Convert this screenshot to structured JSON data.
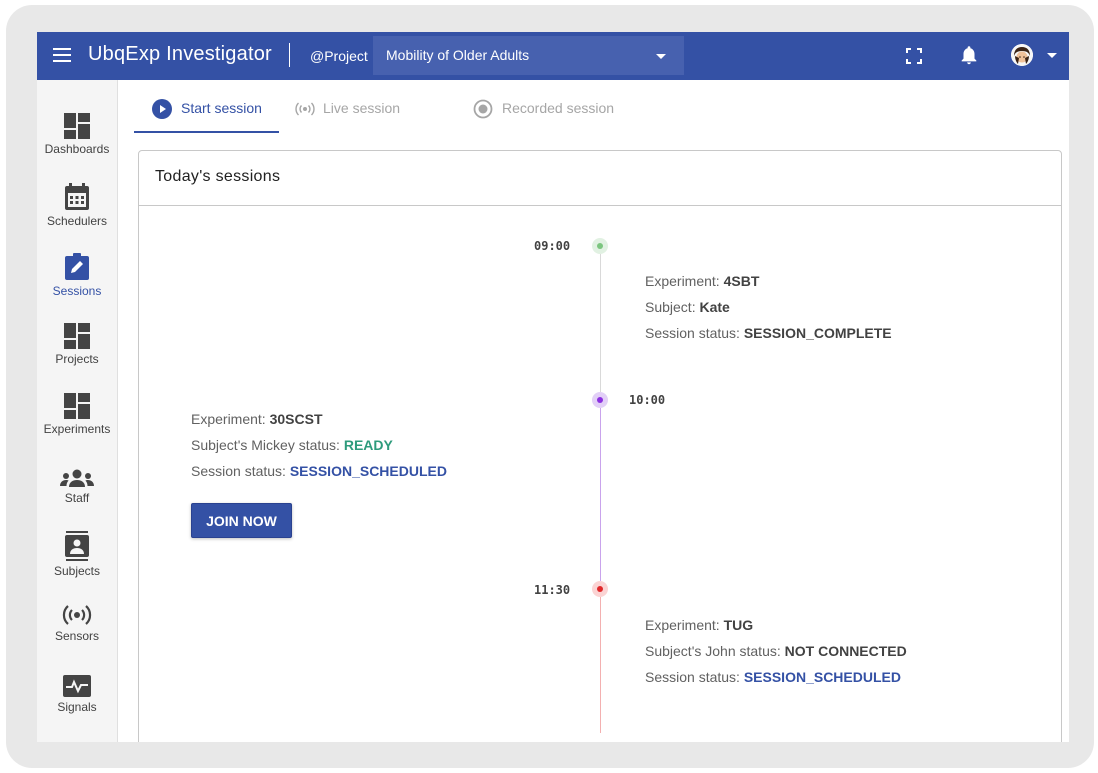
{
  "topbar": {
    "app_title": "UbqExp Investigator",
    "project_prefix": "@Project",
    "project_selected": "Mobility of Older Adults",
    "icons": [
      "menu-icon",
      "fullscreen-icon",
      "bell-icon",
      "avatar",
      "chevron-down-icon"
    ]
  },
  "sidebar": {
    "items": [
      {
        "label": "Dashboards",
        "icon": "dashboard-icon"
      },
      {
        "label": "Schedulers",
        "icon": "calendar-icon"
      },
      {
        "label": "Sessions",
        "icon": "edit-icon"
      },
      {
        "label": "Projects",
        "icon": "dashboard-icon"
      },
      {
        "label": "Experiments",
        "icon": "dashboard-icon"
      },
      {
        "label": "Staff",
        "icon": "group-icon"
      },
      {
        "label": "Subjects",
        "icon": "contact-icon"
      },
      {
        "label": "Sensors",
        "icon": "broadcast-icon"
      },
      {
        "label": "Signals",
        "icon": "pulse-icon"
      }
    ],
    "active": "Sessions"
  },
  "tabs": [
    {
      "label": "Start session",
      "icon": "play-icon",
      "active": true
    },
    {
      "label": "Live session",
      "icon": "broadcast-icon",
      "active": false
    },
    {
      "label": "Recorded session",
      "icon": "record-icon",
      "active": false
    }
  ],
  "card": {
    "title": "Today's sessions"
  },
  "timeline": [
    {
      "time": "09:00",
      "dot_color": "#7cc57f",
      "experiment_label": "Experiment:",
      "experiment": "4SBT",
      "subject_label": "Subject:",
      "subject": "Kate",
      "status_label": "Session status:",
      "status": "SESSION_COMPLETE"
    },
    {
      "time": "10:00",
      "dot_color": "#8b2fe0",
      "experiment_label": "Experiment:",
      "experiment": "30SCST",
      "subject_label": "Subject's Mickey status:",
      "subject_status": "READY",
      "status_label": "Session status:",
      "status": "SESSION_SCHEDULED",
      "button": "JOIN NOW"
    },
    {
      "time": "11:30",
      "dot_color": "#e0282a",
      "experiment_label": "Experiment:",
      "experiment": "TUG",
      "subject_label": "Subject's John status:",
      "subject_status": "NOT CONNECTED",
      "status_label": "Session status:",
      "status": "SESSION_SCHEDULED"
    }
  ],
  "colors": {
    "brand": "#3451a5",
    "ready": "#2e9b7c"
  }
}
